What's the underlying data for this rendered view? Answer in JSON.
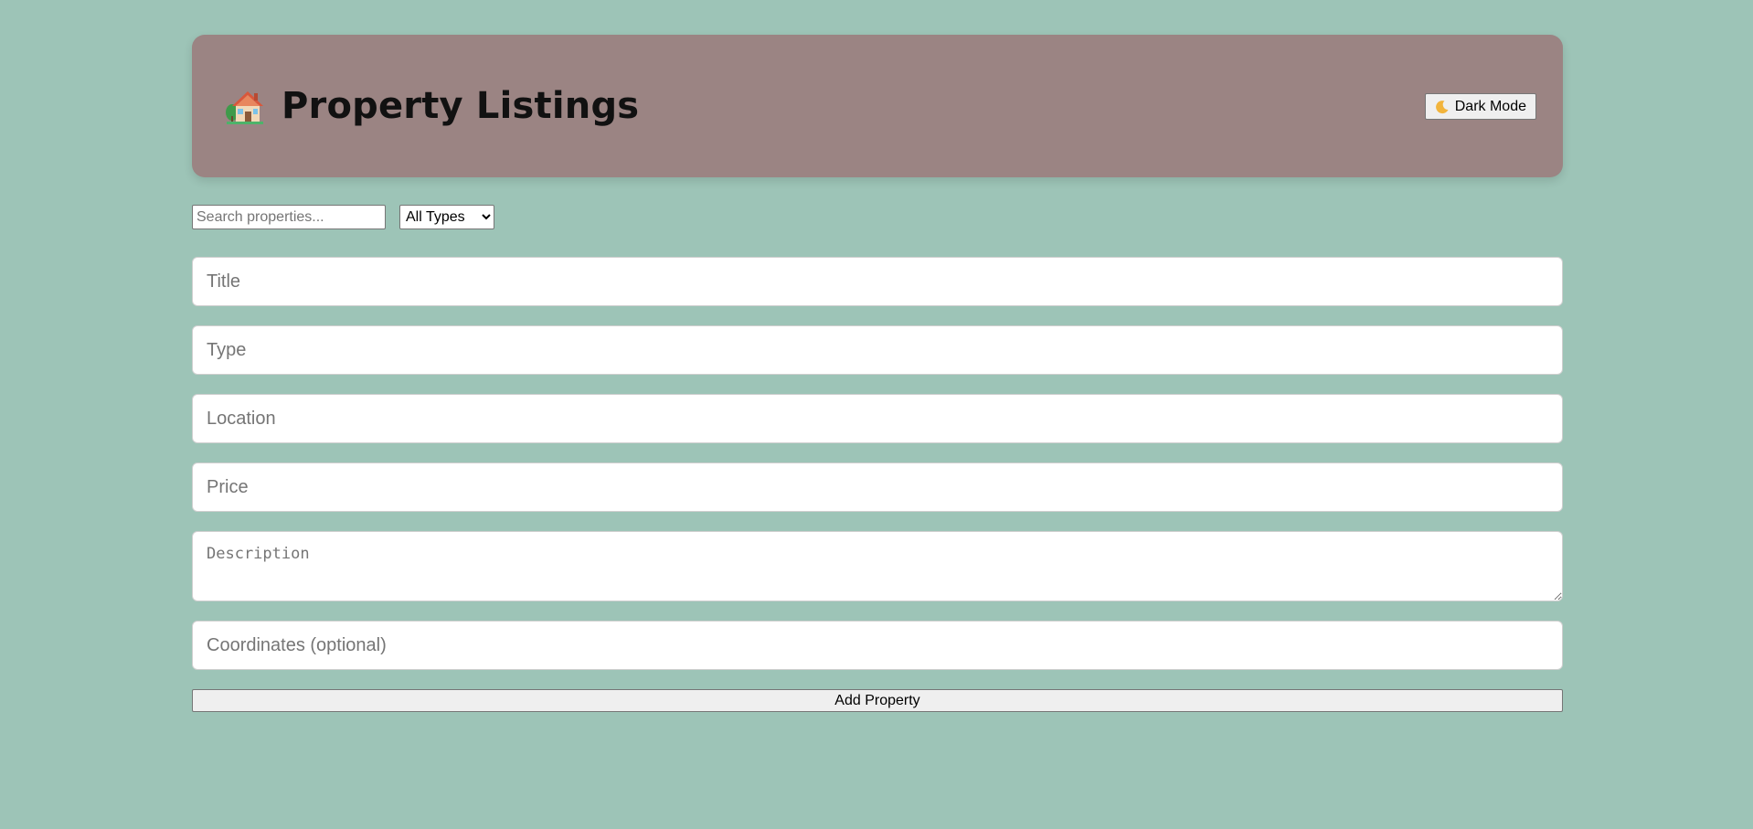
{
  "header": {
    "title": "Property Listings",
    "icon": "house-icon",
    "dark_mode_label": "Dark Mode",
    "dark_mode_icon": "moon-icon"
  },
  "filters": {
    "search_placeholder": "Search properties...",
    "type_filter_selected": "All Types"
  },
  "form": {
    "title_placeholder": "Title",
    "type_placeholder": "Type",
    "location_placeholder": "Location",
    "price_placeholder": "Price",
    "description_placeholder": "Description",
    "coordinates_placeholder": "Coordinates (optional)",
    "submit_label": "Add Property"
  },
  "colors": {
    "page_background": "#9dc4b7",
    "header_background": "#9b8483"
  }
}
